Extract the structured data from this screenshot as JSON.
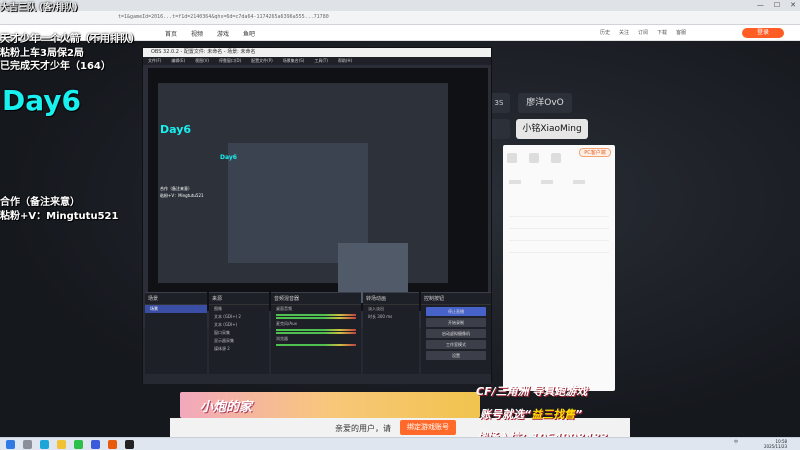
{
  "browser": {
    "url": "t=1&gameId=2016...t=f1d=2140364&qhs=6d=c7da64-1174265a6396a555...71780"
  },
  "site_nav": {
    "items": [
      "首页",
      "视频",
      "游戏",
      "鱼吧"
    ],
    "right_items": [
      "历史",
      "关注",
      "订阅",
      "下载",
      "客服"
    ],
    "login_label": "登录"
  },
  "overlay": {
    "line1": "大吉三队  (客/排队)",
    "line2": "天才少年一个火箭（不用排队）",
    "line3": "粘粉上车3局保2局",
    "line4": "已完成天才少年（164）",
    "day": "Day6",
    "line5": "合作（备注来意）",
    "line6": "粘粉+V：Mingtutu521"
  },
  "streamers": {
    "tag_a": "3S",
    "tag_b": "廖洋OvO",
    "tag_d": "小铭XiaoMing",
    "pc_label": "PC客户端"
  },
  "obs": {
    "title": "OBS 32.0.2 - 配置文件: 未命名 - 场景: 未命名",
    "menu": [
      "文件(F)",
      "编辑(E)",
      "视图(V)",
      "停靠窗口(D)",
      "配置文件(P)",
      "场景集合(S)",
      "工具(T)",
      "帮助(H)"
    ],
    "mini_day": "Day6",
    "mini_line5": "合作（备注来意）",
    "mini_line6": "粘粉+V：Mingtutu521",
    "docks": {
      "scenes": {
        "title": "场景",
        "items": [
          "场景"
        ]
      },
      "sources": {
        "title": "来源",
        "items": [
          "图像",
          "文本 (GDI+) 2",
          "文本 (GDI+)",
          "窗口采集",
          "显示器采集",
          "媒体源 2"
        ]
      },
      "mixer": {
        "title": "音频混音器",
        "channels": [
          "桌面音频",
          "麦克风/Aux",
          "浏览器"
        ]
      },
      "transitions": {
        "title": "转场动画",
        "type": "淡入淡出",
        "duration_label": "时长",
        "duration": "300 ms"
      },
      "controls": {
        "title": "控制按钮",
        "buttons": [
          "停止直播",
          "开始录制",
          "启动虚拟摄像机",
          "工作室模式",
          "设置"
        ]
      }
    }
  },
  "banner": {
    "title": "小炮的家"
  },
  "ads": {
    "line1": "CF/三角洲  导具跑游戏",
    "line2_pre": "账号就选“",
    "line2_hi": "益三找售",
    "line2_post": "”",
    "line3": "战场入坑：1064998483"
  },
  "login_strip": {
    "text": "亲爱的用户，请",
    "button": "绑定游戏账号"
  },
  "taskbar": {
    "clock_time": "10:58",
    "clock_date": "2025/11/23",
    "lang": "中"
  }
}
